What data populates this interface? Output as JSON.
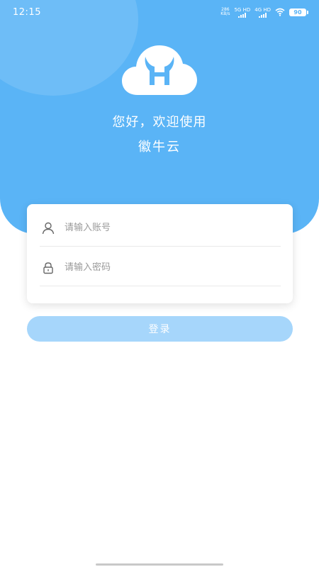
{
  "status_bar": {
    "time": "12:15",
    "net_speed": "286\nKB/s",
    "net1": "5G HD",
    "net2": "4G HD",
    "battery": "90",
    "icons": [
      "signal-icon",
      "signal-icon",
      "wifi-icon",
      "battery-icon"
    ]
  },
  "header": {
    "logo_icon": "cloud-h-logo-icon",
    "welcome": "您好，欢迎使用",
    "app_name": "徽牛云"
  },
  "form": {
    "account_placeholder": "请输入账号",
    "password_placeholder": "请输入密码",
    "account_icon": "user-icon",
    "password_icon": "lock-icon"
  },
  "login_button": {
    "label": "登录"
  },
  "colors": {
    "primary": "#5ab4f6",
    "button_disabled": "#a6d6fb",
    "logo_letter": "#5ab4f6"
  }
}
